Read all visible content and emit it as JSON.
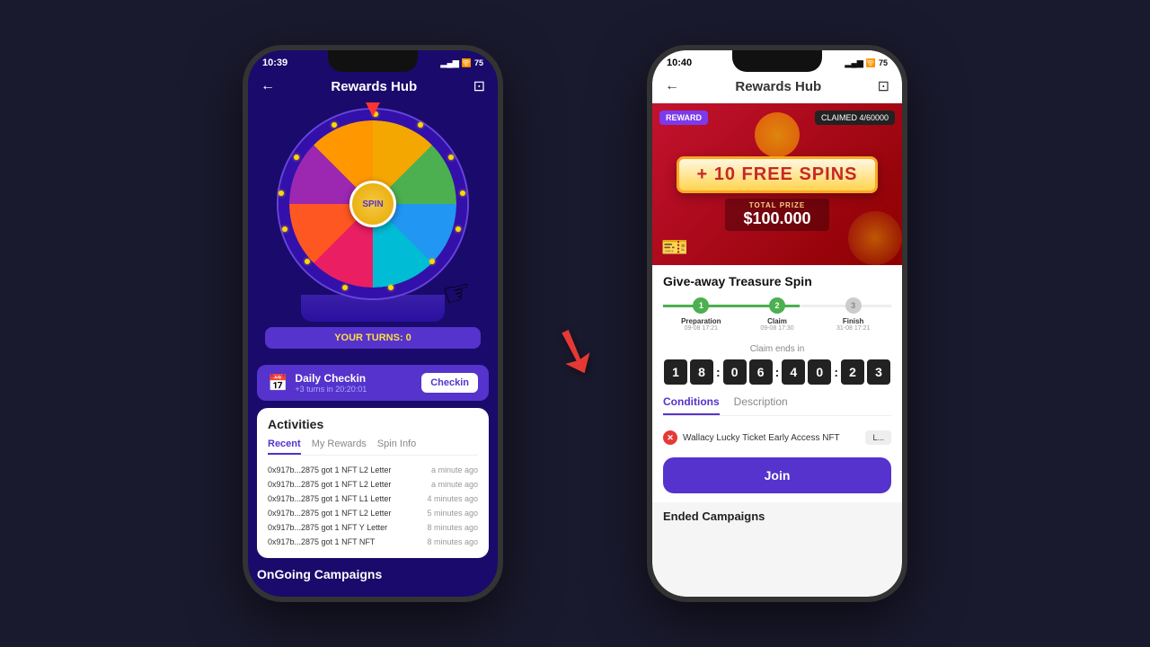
{
  "leftPhone": {
    "statusBar": {
      "time": "10:39",
      "battery": "75"
    },
    "header": {
      "title": "Rewards Hub",
      "backIcon": "←",
      "settingsIcon": "⊡"
    },
    "wheel": {
      "spinLabel": "SPIN",
      "turnsText": "YOUR TURNS: 0",
      "handIcon": "☞"
    },
    "checkin": {
      "icon": "📅",
      "title": "Daily Checkin",
      "subtitle": "+3 turns in 20:20:01",
      "buttonLabel": "Checkin"
    },
    "activities": {
      "sectionTitle": "Activities",
      "tabs": [
        {
          "label": "Recent",
          "active": true
        },
        {
          "label": "My Rewards",
          "active": false
        },
        {
          "label": "Spin Info",
          "active": false
        }
      ],
      "rows": [
        {
          "text": "0x917b...2875 got 1 NFT L2 Letter",
          "time": "a minute ago"
        },
        {
          "text": "0x917b...2875 got 1 NFT L2 Letter",
          "time": "a minute ago"
        },
        {
          "text": "0x917b...2875 got 1 NFT L1 Letter",
          "time": "4 minutes ago"
        },
        {
          "text": "0x917b...2875 got 1 NFT L2 Letter",
          "time": "5 minutes ago"
        },
        {
          "text": "0x917b...2875 got 1 NFT Y Letter",
          "time": "8 minutes ago"
        },
        {
          "text": "0x917b...2875 got 1 NFT NFT",
          "time": "8 minutes ago"
        }
      ]
    },
    "ongoingTitle": "OnGoing Campaigns"
  },
  "rightPhone": {
    "statusBar": {
      "time": "10:40",
      "battery": "75"
    },
    "header": {
      "title": "Rewards Hub",
      "backIcon": "←",
      "settingsIcon": "⊡"
    },
    "banner": {
      "rewardBadge": "REWARD",
      "claimedBadge": "CLAIMED 4/60000",
      "freeSpinsText": "+ 10 FREE SPINS",
      "totalPrizeLabel": "TOTAL PRIZE",
      "totalPrizeValue": "$100.000",
      "ticketEmoji": "🎫"
    },
    "giveaway": {
      "title": "Give-away Treasure Spin",
      "steps": [
        {
          "label": "Preparation",
          "date": "09-08 17:21",
          "state": "active",
          "num": "1"
        },
        {
          "label": "Claim",
          "date": "09-08 17:30",
          "state": "current",
          "num": "2"
        },
        {
          "label": "Finish",
          "date": "31-08 17:21",
          "state": "inactive",
          "num": "3"
        }
      ],
      "claimEndsLabel": "Claim ends in",
      "countdown": {
        "h1": "1",
        "h2": "8",
        "m1": "0",
        "m2": "6",
        "s1": "4",
        "s2": "0",
        "ms1": "2",
        "ms2": "3"
      }
    },
    "conditionsTabs": [
      {
        "label": "Conditions",
        "active": true
      },
      {
        "label": "Description",
        "active": false
      }
    ],
    "conditions": [
      {
        "text": "Wallacy Lucky Ticket Early Access NFT",
        "buttonLabel": "L..."
      }
    ],
    "joinButton": "Join",
    "endedTitle": "Ended Campaigns"
  }
}
